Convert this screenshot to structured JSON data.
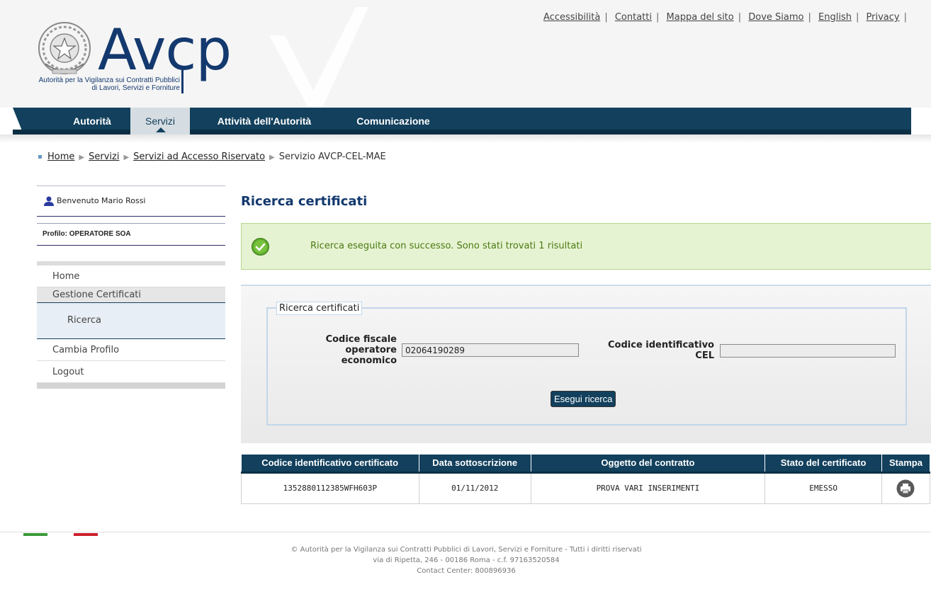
{
  "colors": {
    "brand": "#13396e",
    "nav": "#12405d",
    "success_bg": "#e6f3d2",
    "success_text": "#4a7a12"
  },
  "logo": {
    "word": "Avcp",
    "subtitle_line1": "Autorità per la Vigilanza sui Contratti Pubblici",
    "subtitle_line2": "di Lavori, Servizi e Forniture"
  },
  "top_links": [
    "Accessibilità",
    "Contatti",
    "Mappa del sito",
    "Dove Siamo",
    "English",
    "Privacy"
  ],
  "nav": {
    "items": [
      {
        "label": "Autorità"
      },
      {
        "label": "Servizi"
      },
      {
        "label": "Attività dell'Autorità"
      },
      {
        "label": "Comunicazione"
      }
    ],
    "active": "Servizi"
  },
  "breadcrumb": {
    "items": [
      "Home",
      "Servizi",
      "Servizi ad Accesso Riservato"
    ],
    "current": "Servizio AVCP-CEL-MAE"
  },
  "sidebar": {
    "welcome": "Benvenuto Mario Rossi",
    "profile": "Profilo: OPERATORE SOA",
    "menu": {
      "home": "Home",
      "group": "Gestione Certificati",
      "sub": "Ricerca",
      "change_profile": "Cambia Profilo",
      "logout": "Logout"
    }
  },
  "main": {
    "title": "Ricerca certificati",
    "success_message": "Ricerca eseguita con successo. Sono stati trovati 1 risultati"
  },
  "search": {
    "legend": "Ricerca certificati",
    "field1_label_line1": "Codice fiscale",
    "field1_label_line2": "operatore",
    "field1_label_line3": "economico",
    "field1_value": "02064190289",
    "field2_label_line1": "Codice identificativo",
    "field2_label_line2": "CEL",
    "field2_value": "",
    "button": "Esegui ricerca"
  },
  "table": {
    "headers": [
      "Codice identificativo certificato",
      "Data sottoscrizione",
      "Oggetto del contratto",
      "Stato del certificato",
      "Stampa"
    ],
    "rows": [
      {
        "code": "1352880112385WFH603P",
        "date": "01/11/2012",
        "object": "PROVA VARI INSERIMENTI",
        "status": "EMESSO",
        "print_icon": "printer-icon"
      }
    ]
  },
  "footer": {
    "line1": "© Autorità per la Vigilanza sui Contratti Pubblici di Lavori, Servizi e Forniture - Tutti i diritti riservati",
    "line2": "via di Ripetta, 246 - 00186 Roma - c.f. 97163520584",
    "line3": "Contact Center: 800896936"
  }
}
